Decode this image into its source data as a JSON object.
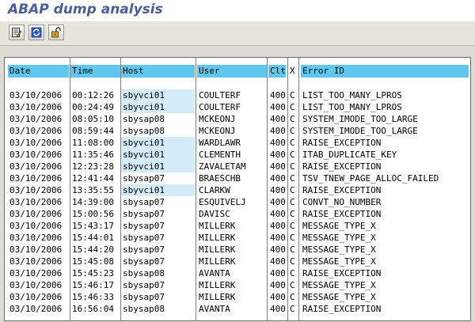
{
  "title": "ABAP dump analysis",
  "toolbar": {
    "buttons": [
      {
        "icon": "display-icon"
      },
      {
        "icon": "refresh-icon"
      },
      {
        "icon": "unlock-icon"
      }
    ]
  },
  "table": {
    "headers": {
      "date": "Date",
      "time": "Time",
      "host": "Host",
      "user": "User",
      "clt": "Clt",
      "x": "X",
      "error": "Error ID"
    },
    "rows": [
      {
        "date": "03/10/2006",
        "time": "00:12:26",
        "host": "sbyvci01",
        "user": "COULTERF",
        "clt": "400",
        "x": "C",
        "error": "LIST_TOO_MANY_LPROS",
        "highlight": true
      },
      {
        "date": "03/10/2006",
        "time": "00:24:49",
        "host": "sbyvci01",
        "user": "COULTERF",
        "clt": "400",
        "x": "C",
        "error": "LIST_TOO_MANY_LPROS",
        "highlight": true
      },
      {
        "date": "03/10/2006",
        "time": "08:05:10",
        "host": "sbysap08",
        "user": "MCKEONJ",
        "clt": "400",
        "x": "C",
        "error": "SYSTEM_IMODE_TOO_LARGE",
        "highlight": false
      },
      {
        "date": "03/10/2006",
        "time": "08:59:44",
        "host": "sbysap08",
        "user": "MCKEONJ",
        "clt": "400",
        "x": "C",
        "error": "SYSTEM_IMODE_TOO_LARGE",
        "highlight": false
      },
      {
        "date": "03/10/2006",
        "time": "11:08:00",
        "host": "sbyvci01",
        "user": "WARDLAWR",
        "clt": "400",
        "x": "C",
        "error": "RAISE_EXCEPTION",
        "highlight": true
      },
      {
        "date": "03/10/2006",
        "time": "11:35:46",
        "host": "sbyvci01",
        "user": "CLEMENTH",
        "clt": "400",
        "x": "C",
        "error": "ITAB_DUPLICATE_KEY",
        "highlight": true
      },
      {
        "date": "03/10/2006",
        "time": "12:23:28",
        "host": "sbyvci01",
        "user": "ZAVALETAM",
        "clt": "400",
        "x": "C",
        "error": "RAISE_EXCEPTION",
        "highlight": true
      },
      {
        "date": "03/10/2006",
        "time": "12:41:44",
        "host": "sbysap07",
        "user": "BRAESCHB",
        "clt": "400",
        "x": "C",
        "error": "TSV_TNEW_PAGE_ALLOC_FAILED",
        "highlight": false
      },
      {
        "date": "03/10/2006",
        "time": "13:35:55",
        "host": "sbyvci01",
        "user": "CLARKW",
        "clt": "400",
        "x": "C",
        "error": "RAISE_EXCEPTION",
        "highlight": true
      },
      {
        "date": "03/10/2006",
        "time": "14:39:00",
        "host": "sbysap07",
        "user": "ESQUIVELJ",
        "clt": "400",
        "x": "C",
        "error": "CONVT_NO_NUMBER",
        "highlight": false
      },
      {
        "date": "03/10/2006",
        "time": "15:00:56",
        "host": "sbysap07",
        "user": "DAVISC",
        "clt": "400",
        "x": "C",
        "error": "RAISE_EXCEPTION",
        "highlight": false
      },
      {
        "date": "03/10/2006",
        "time": "15:43:17",
        "host": "sbysap07",
        "user": "MILLERK",
        "clt": "400",
        "x": "C",
        "error": "MESSAGE_TYPE_X",
        "highlight": false
      },
      {
        "date": "03/10/2006",
        "time": "15:44:01",
        "host": "sbysap07",
        "user": "MILLERK",
        "clt": "400",
        "x": "C",
        "error": "MESSAGE_TYPE_X",
        "highlight": false
      },
      {
        "date": "03/10/2006",
        "time": "15:44:20",
        "host": "sbysap07",
        "user": "MILLERK",
        "clt": "400",
        "x": "C",
        "error": "MESSAGE_TYPE_X",
        "highlight": false
      },
      {
        "date": "03/10/2006",
        "time": "15:45:08",
        "host": "sbysap07",
        "user": "MILLERK",
        "clt": "400",
        "x": "C",
        "error": "MESSAGE_TYPE_X",
        "highlight": false
      },
      {
        "date": "03/10/2006",
        "time": "15:45:23",
        "host": "sbysap08",
        "user": "AVANTA",
        "clt": "400",
        "x": "C",
        "error": "RAISE_EXCEPTION",
        "highlight": false
      },
      {
        "date": "03/10/2006",
        "time": "15:46:17",
        "host": "sbysap07",
        "user": "MILLERK",
        "clt": "400",
        "x": "C",
        "error": "MESSAGE_TYPE_X",
        "highlight": false
      },
      {
        "date": "03/10/2006",
        "time": "15:46:33",
        "host": "sbysap07",
        "user": "MILLERK",
        "clt": "400",
        "x": "C",
        "error": "MESSAGE_TYPE_X",
        "highlight": false
      },
      {
        "date": "03/10/2006",
        "time": "16:56:04",
        "host": "sbysap08",
        "user": "AVANTA",
        "clt": "400",
        "x": "C",
        "error": "RAISE_EXCEPTION",
        "highlight": false
      }
    ]
  }
}
